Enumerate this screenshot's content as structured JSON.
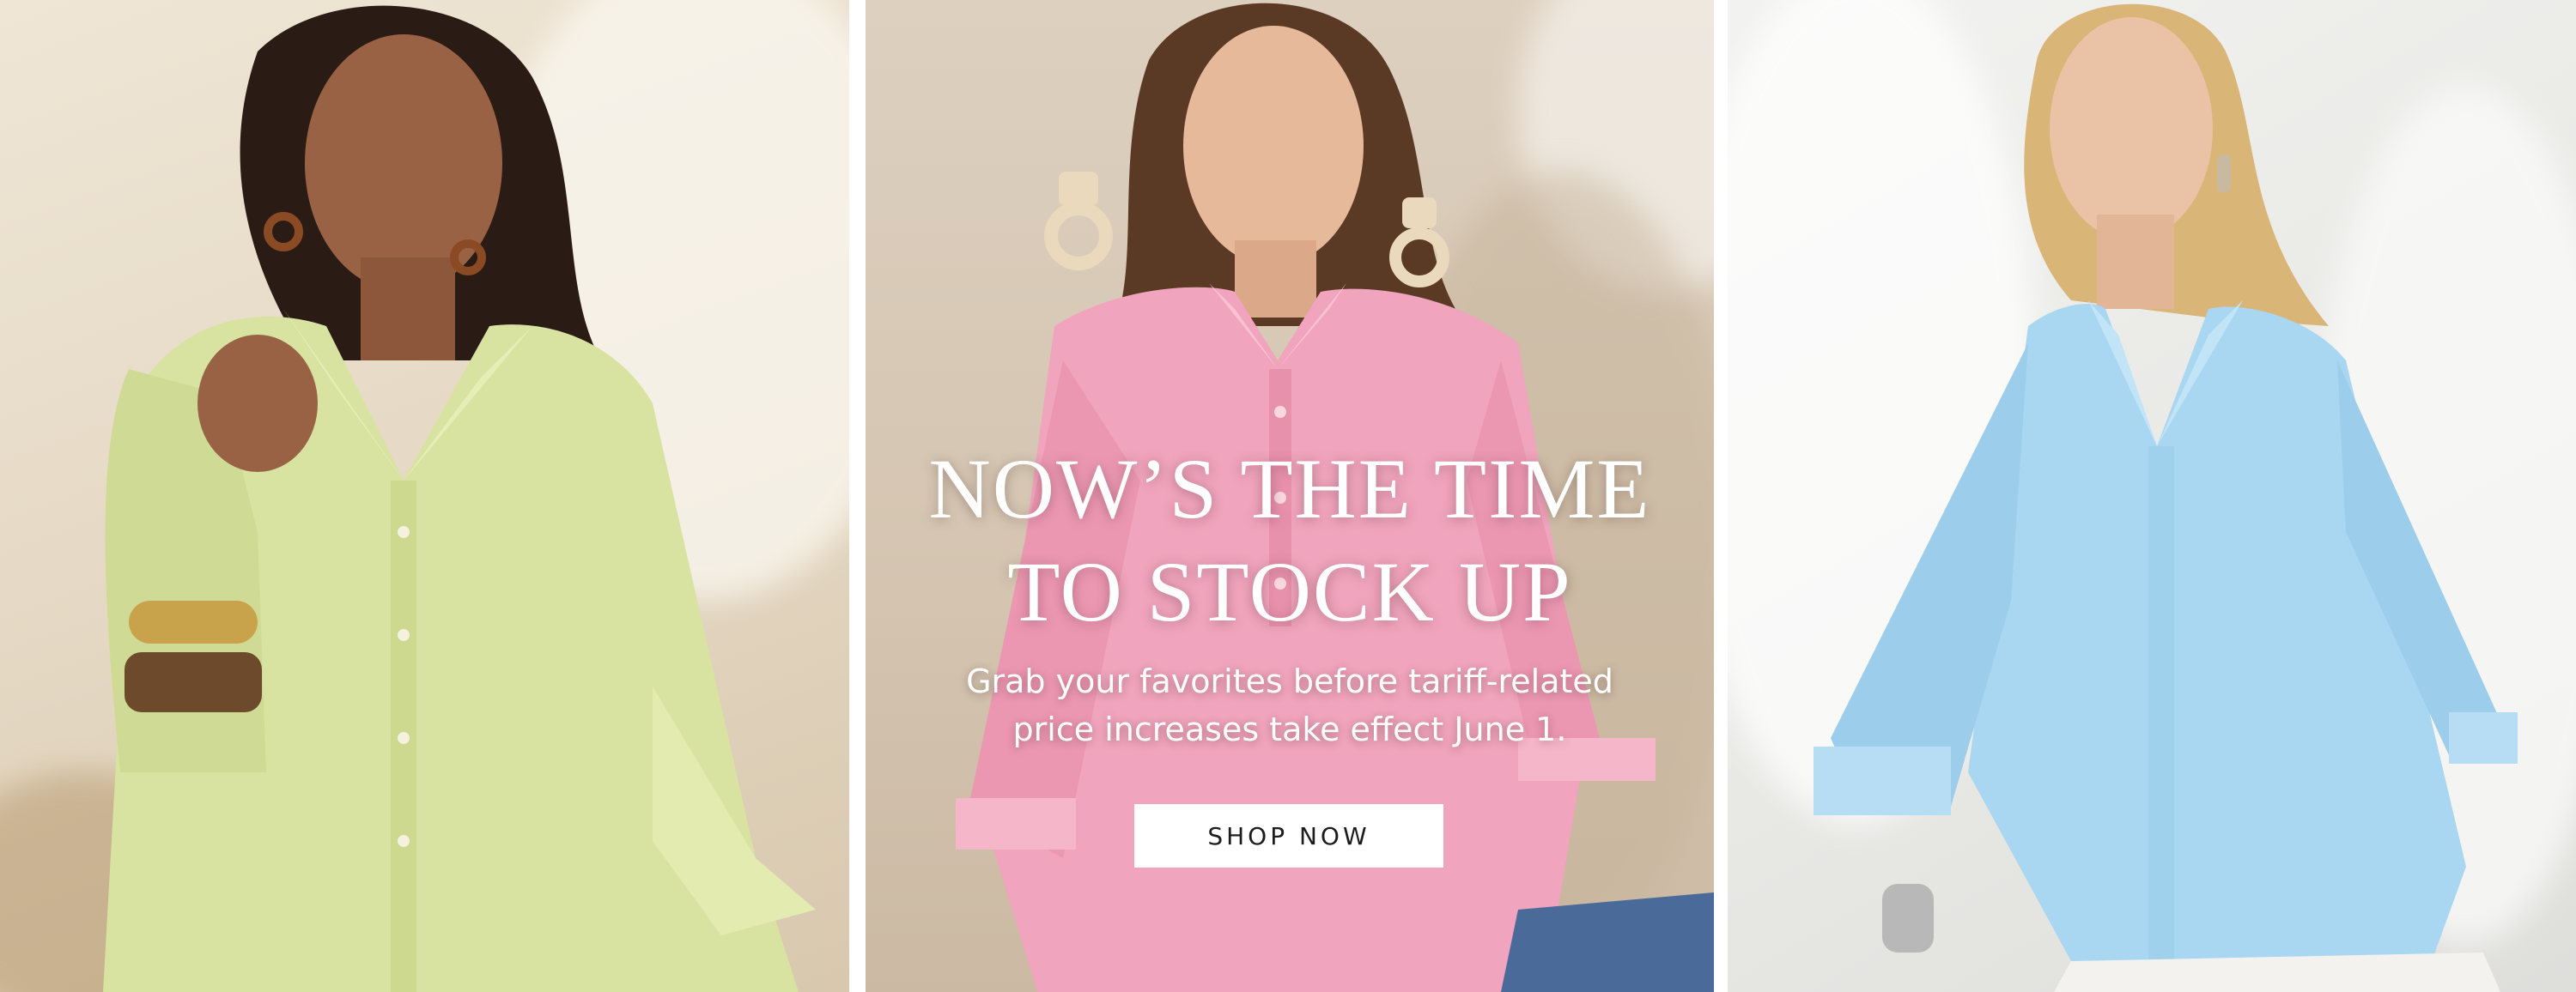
{
  "promo": {
    "headline_line1": "NOW’S THE TIME",
    "headline_line2": "TO STOCK UP",
    "subcopy_line1": "Grab your favorites before tariff-related",
    "subcopy_line2": "price increases take effect June 1.",
    "cta_label": "SHOP NOW"
  },
  "photos": [
    {
      "name": "model-lime-shirt",
      "shirt_color": "#d8e3a1"
    },
    {
      "name": "model-pink-shirt",
      "shirt_color": "#f0a4bd"
    },
    {
      "name": "model-blue-shirt",
      "shirt_color": "#a9d6f0"
    }
  ],
  "colors": {
    "cta_background": "#ffffff",
    "cta_text": "#1c1c1c",
    "headline_text": "#ffffff",
    "gutter": "#ffffff"
  }
}
